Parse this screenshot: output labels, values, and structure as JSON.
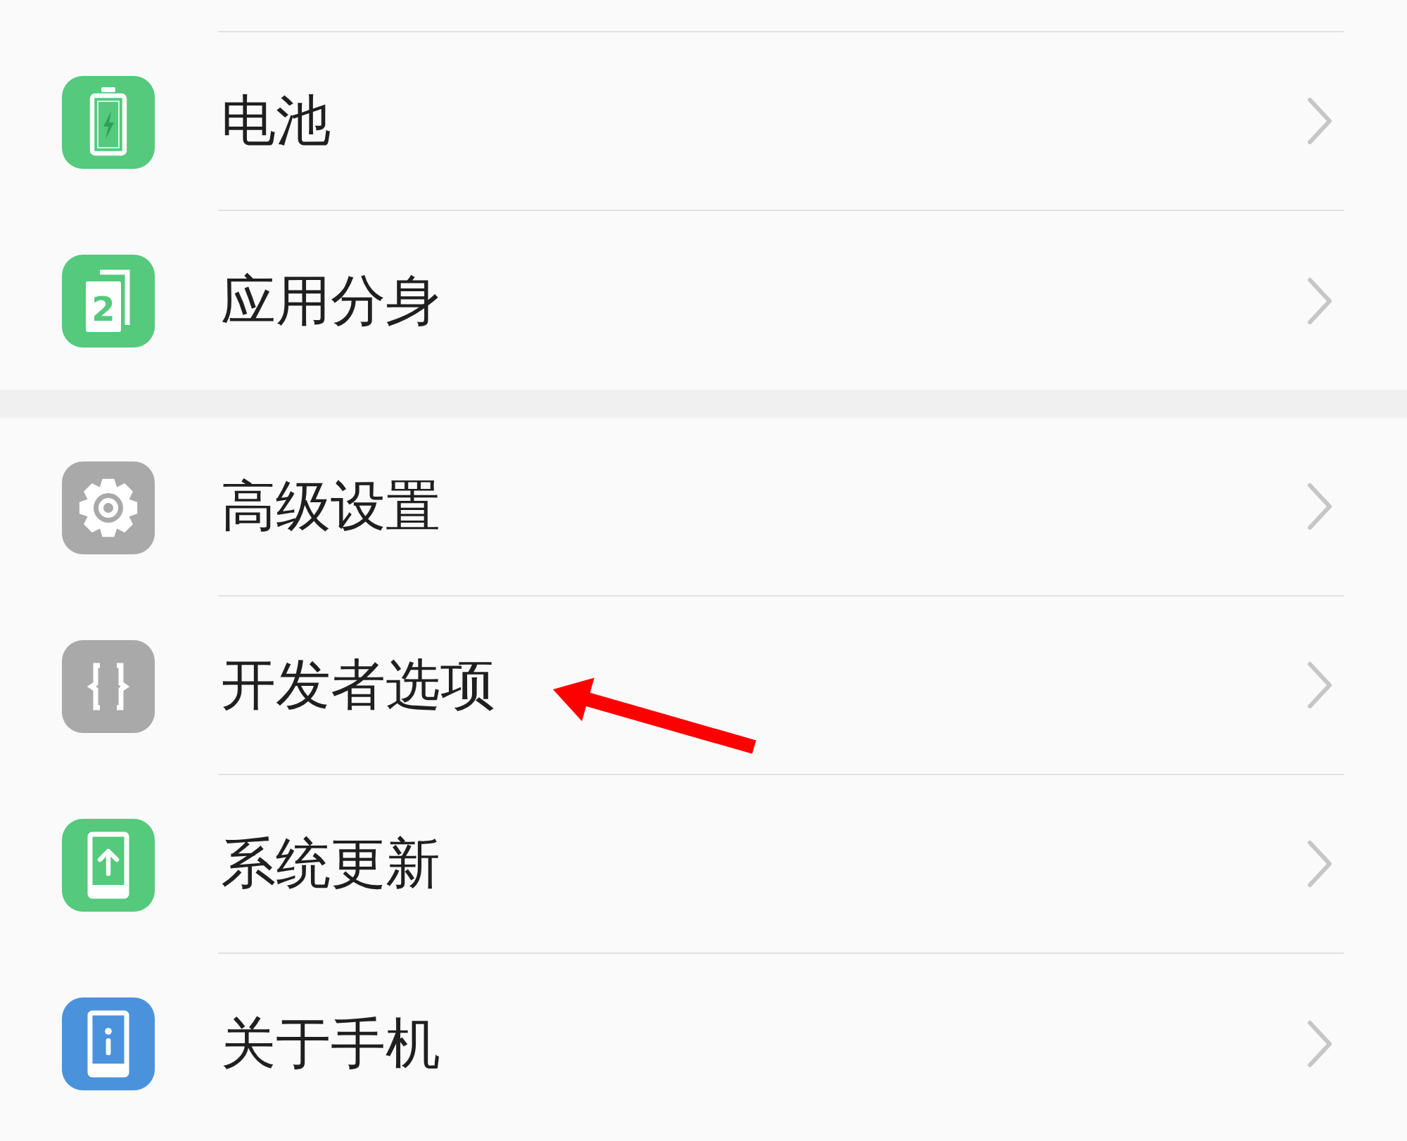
{
  "groups": [
    {
      "items": [
        {
          "label": "电池",
          "kind": "battery",
          "pointer_arrow": false
        },
        {
          "label": "应用分身",
          "kind": "twin",
          "icon_text": "2",
          "pointer_arrow": false
        }
      ]
    },
    {
      "items": [
        {
          "label": "高级设置",
          "kind": "gear",
          "pointer_arrow": false
        },
        {
          "label": "开发者选项",
          "kind": "braces",
          "pointer_arrow": true
        },
        {
          "label": "系统更新",
          "kind": "update",
          "pointer_arrow": false
        },
        {
          "label": "关于手机",
          "kind": "info",
          "pointer_arrow": false
        }
      ]
    }
  ]
}
